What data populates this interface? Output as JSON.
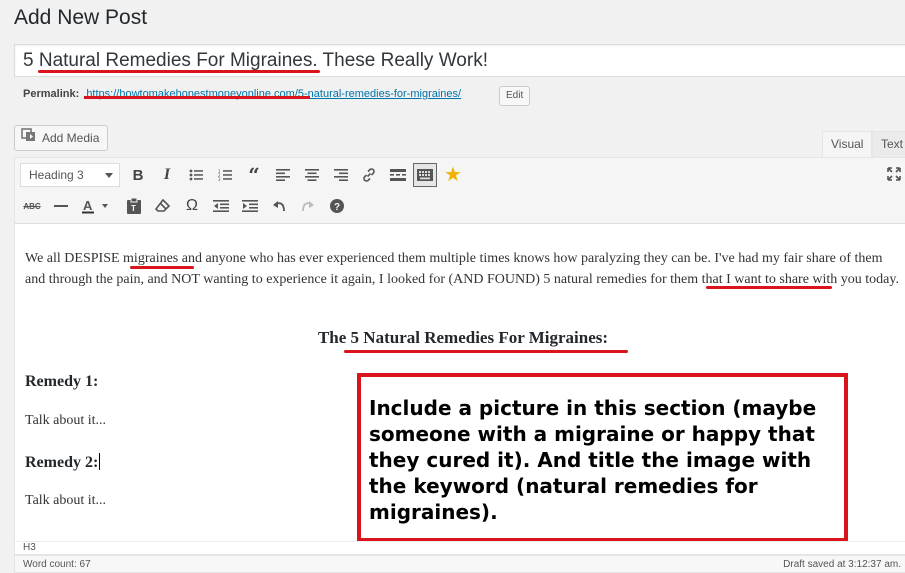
{
  "page": {
    "title": "Add New Post"
  },
  "post": {
    "title": "5 Natural Remedies For Migraines. These Really Work!",
    "permalink_label": "Permalink:",
    "permalink_url": "https://howtomakehonestmoneyonline.com/5-natural-remedies-for-migraines/",
    "edit_label": "Edit"
  },
  "media": {
    "add_media_label": "Add Media"
  },
  "editor_tabs": [
    {
      "label": "Visual",
      "active": true
    },
    {
      "label": "Text",
      "active": false
    }
  ],
  "toolbar": {
    "format_value": "Heading 3",
    "row1_icons": [
      "bold-icon",
      "italic-icon",
      "bullet-list-icon",
      "numbered-list-icon",
      "blockquote-icon",
      "align-left-icon",
      "align-center-icon",
      "align-right-icon",
      "link-icon",
      "read-more-icon",
      "toolbar-toggle-icon",
      "star-icon"
    ],
    "row2_icons": [
      "strikethrough-icon",
      "horizontal-line-icon",
      "text-color-icon",
      "paste-text-icon",
      "clear-formatting-icon",
      "special-character-icon",
      "outdent-icon",
      "indent-icon",
      "undo-icon",
      "redo-icon",
      "help-icon"
    ],
    "fullscreen_icon": "fullscreen-icon"
  },
  "content": {
    "paragraph1": "We all DESPISE migraines and anyone who has ever experienced them multiple times knows how paralyzing they can be. I've had my fair share of them and through the pain, and NOT wanting to experience it again, I looked for (AND FOUND) 5 natural remedies for them that I want to share with you today.",
    "heading_main": "The 5 Natural Remedies For Migraines:",
    "remedy1_heading": "Remedy 1:",
    "remedy1_text": "Talk about it...",
    "remedy2_heading": "Remedy 2:",
    "remedy2_text": "Talk about it..."
  },
  "callout": {
    "text": "Include a picture in this section (maybe someone with a migraine or happy that they cured it). And title the image with the keyword (natural remedies for migraines).",
    "color": "#d9141b"
  },
  "status": {
    "path": "H3",
    "word_count": "Word count: 67",
    "draft_saved": "Draft saved at 3:12:37 am."
  },
  "colors": {
    "annotation": "#d9141b",
    "link": "#0073aa",
    "star": "#f0b400"
  }
}
